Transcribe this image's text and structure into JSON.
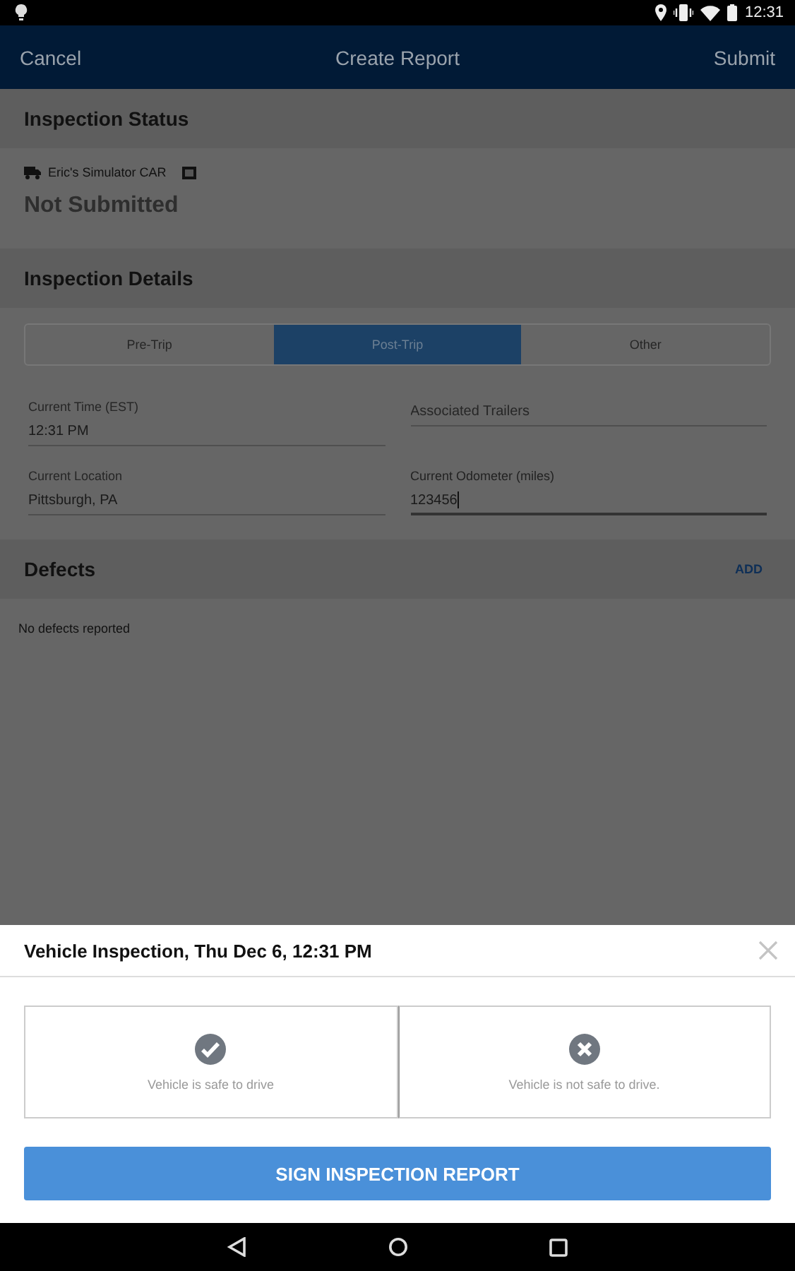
{
  "status_bar": {
    "time": "12:31"
  },
  "header": {
    "cancel": "Cancel",
    "title": "Create Report",
    "submit": "Submit"
  },
  "inspection_status": {
    "title": "Inspection Status",
    "vehicle": "Eric's Simulator CAR",
    "status": "Not Submitted"
  },
  "inspection_details": {
    "title": "Inspection Details",
    "tabs": [
      {
        "label": "Pre-Trip",
        "selected": false
      },
      {
        "label": "Post-Trip",
        "selected": true
      },
      {
        "label": "Other",
        "selected": false
      }
    ],
    "fields": [
      {
        "label": "Current Time (EST)",
        "value": "12:31 PM",
        "focused": false
      },
      {
        "placeholder": "Associated Trailers",
        "focused": false
      },
      {
        "label": "Current Location",
        "value": "Pittsburgh, PA",
        "focused": false
      },
      {
        "label": "Current Odometer (miles)",
        "value": "123456",
        "focused": true
      }
    ]
  },
  "defects": {
    "title": "Defects",
    "add": "ADD",
    "empty": "No defects reported"
  },
  "sheet": {
    "title": "Vehicle Inspection, Thu Dec 6, 12:31 PM",
    "options": [
      {
        "kind": "safe",
        "label": "Vehicle is safe to drive"
      },
      {
        "kind": "unsafe",
        "label": "Vehicle is not safe to drive."
      }
    ],
    "button": "SIGN INSPECTION REPORT"
  }
}
